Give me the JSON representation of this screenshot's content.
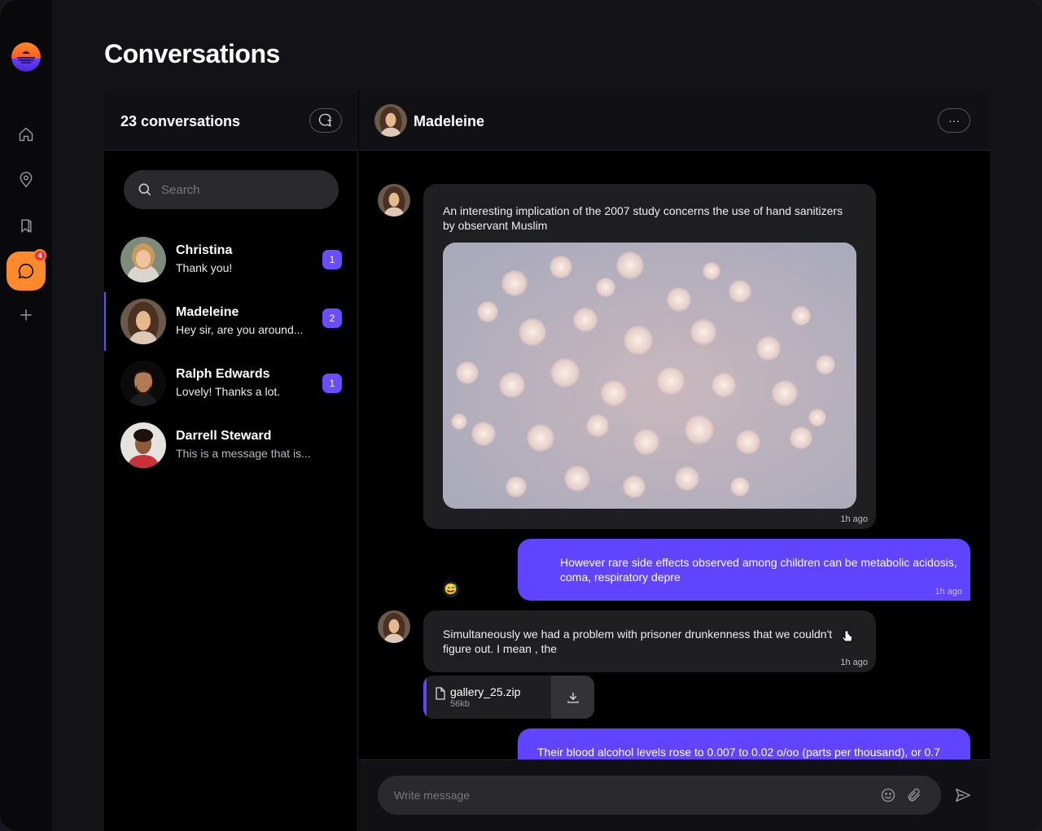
{
  "page_title": "Conversations",
  "sidebar": {
    "items": [
      {
        "icon": "home-icon"
      },
      {
        "icon": "location-pin-icon"
      },
      {
        "icon": "bookmarks-icon"
      },
      {
        "icon": "chat-bubble-icon",
        "badge": "4",
        "active": true
      },
      {
        "icon": "plus-icon"
      }
    ]
  },
  "list": {
    "count_label": "23 conversations",
    "search_placeholder": "Search",
    "conversations": [
      {
        "name": "Christina",
        "preview": "Thank you!",
        "unread": "1"
      },
      {
        "name": "Madeleine",
        "preview": "Hey sir, are you around...",
        "unread": "2",
        "selected": true
      },
      {
        "name": "Ralph Edwards",
        "preview": "Lovely! Thanks a lot.",
        "unread": "1"
      },
      {
        "name": "Darrell Steward",
        "preview": "This is a message that is...",
        "unread": ""
      }
    ]
  },
  "chat": {
    "contact_name": "Madeleine",
    "more_label": "···",
    "messages": [
      {
        "from": "them",
        "text": "An interesting implication of the 2007 study concerns the use of hand sanitizers by observant Muslim",
        "time": "1h ago",
        "reaction": "😅"
      },
      {
        "from": "me",
        "text": "However rare side effects observed among children can be metabolic acidosis, coma, respiratory depre",
        "time": "1h ago"
      },
      {
        "from": "them",
        "text": "Simultaneously we had a problem with prisoner drunkenness that we couldn't figure out. I mean , the",
        "time": "1h ago"
      },
      {
        "from": "me",
        "text": "Their blood alcohol levels rose to 0.007 to 0.02 o/oo (parts per thousand), or 0.7",
        "time": ""
      }
    ],
    "attachment": {
      "file_name": "gallery_25.zip",
      "file_size": "56kb"
    },
    "composer_placeholder": "Write message"
  },
  "colors": {
    "accent": "#6044ff",
    "active_rail": "#ff8a2b",
    "badge": "#e8313f"
  }
}
